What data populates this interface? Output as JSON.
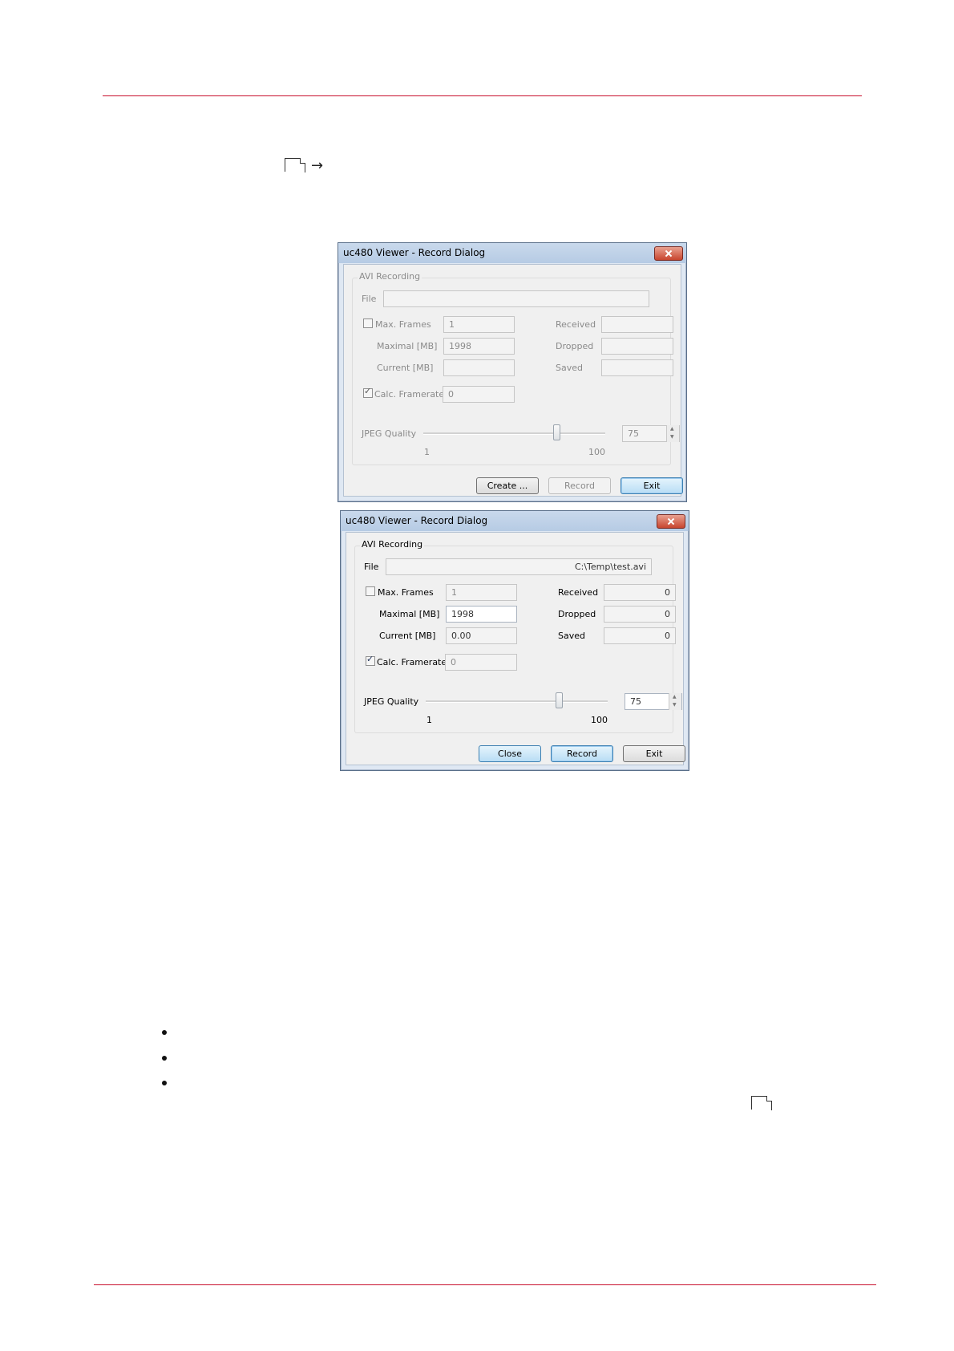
{
  "intro": {
    "arrow": "→"
  },
  "dialogs": [
    {
      "title": "uc480 Viewer - Record Dialog",
      "group_title": "AVI Recording",
      "file_label": "File",
      "file_value": "",
      "max_frames_label": "Max. Frames",
      "max_frames_checked": false,
      "max_frames_value": "1",
      "maximal_label": "Maximal [MB]",
      "maximal_value": "1998",
      "current_label": "Current [MB]",
      "current_value": "",
      "calc_label": "Calc. Framerate",
      "calc_checked": true,
      "calc_value": "0",
      "received_label": "Received",
      "received_value": "",
      "dropped_label": "Dropped",
      "dropped_value": "",
      "saved_label": "Saved",
      "saved_value": "",
      "jpeg_label": "JPEG Quality",
      "jpeg_value": "75",
      "jpeg_min": "1",
      "jpeg_max": "100",
      "buttons": [
        "Create ...",
        "Record",
        "Exit"
      ]
    },
    {
      "title": "uc480 Viewer - Record Dialog",
      "group_title": "AVI Recording",
      "file_label": "File",
      "file_value": "C:\\Temp\\test.avi",
      "max_frames_label": "Max. Frames",
      "max_frames_checked": false,
      "max_frames_value": "1",
      "maximal_label": "Maximal [MB]",
      "maximal_value": "1998",
      "current_label": "Current [MB]",
      "current_value": "0.00",
      "calc_label": "Calc. Framerate",
      "calc_checked": true,
      "calc_value": "0",
      "received_label": "Received",
      "received_value": "0",
      "dropped_label": "Dropped",
      "dropped_value": "0",
      "saved_label": "Saved",
      "saved_value": "0",
      "jpeg_label": "JPEG Quality",
      "jpeg_value": "75",
      "jpeg_min": "1",
      "jpeg_max": "100",
      "buttons": [
        "Close",
        "Record",
        "Exit"
      ]
    }
  ],
  "colors": {
    "accent_rule": "#c8102e"
  }
}
